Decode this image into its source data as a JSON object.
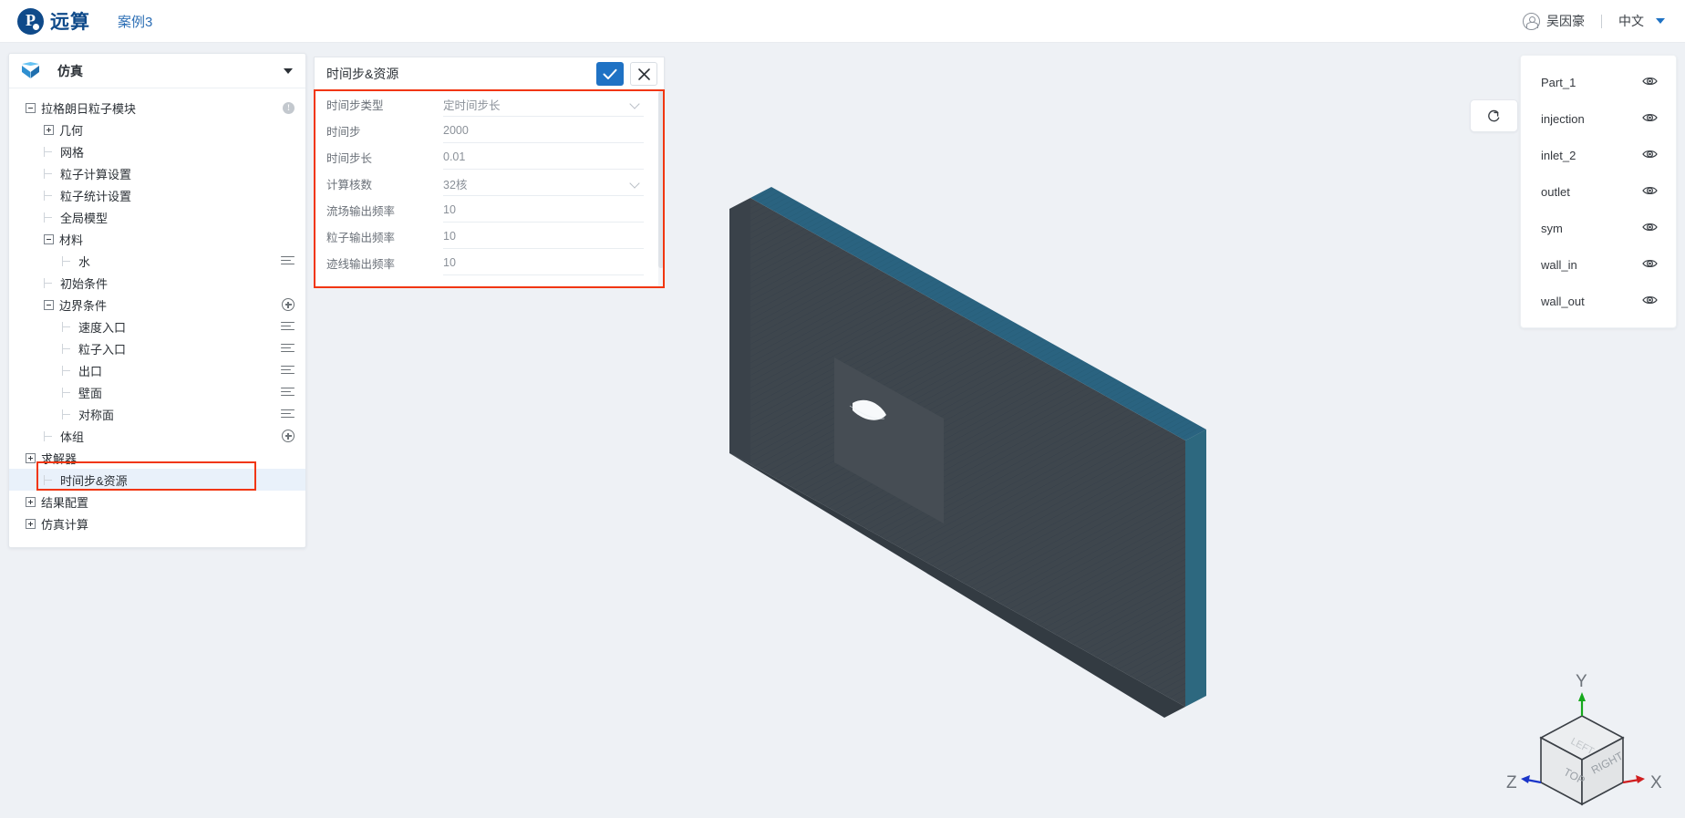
{
  "topbar": {
    "brand_name": "远算",
    "case_name": "案例3",
    "user_name": "吴因豪",
    "language": "中文"
  },
  "left_panel": {
    "header_title": "仿真",
    "tree": [
      {
        "label": "拉格朗日粒子模块",
        "toggle": "minus",
        "indent": 0,
        "tail": "info"
      },
      {
        "label": "几何",
        "toggle": "plus",
        "indent": 1,
        "tail": "none"
      },
      {
        "label": "网格",
        "toggle": "none",
        "indent": 1,
        "tail": "none"
      },
      {
        "label": "粒子计算设置",
        "toggle": "none",
        "indent": 1,
        "tail": "none"
      },
      {
        "label": "粒子统计设置",
        "toggle": "none",
        "indent": 1,
        "tail": "none"
      },
      {
        "label": "全局模型",
        "toggle": "none",
        "indent": 1,
        "tail": "none"
      },
      {
        "label": "材料",
        "toggle": "minus",
        "indent": 1,
        "tail": "none"
      },
      {
        "label": "水",
        "toggle": "none",
        "indent": 2,
        "tail": "menu"
      },
      {
        "label": "初始条件",
        "toggle": "none",
        "indent": 1,
        "tail": "none"
      },
      {
        "label": "边界条件",
        "toggle": "minus",
        "indent": 1,
        "tail": "plus"
      },
      {
        "label": "速度入口",
        "toggle": "none",
        "indent": 2,
        "tail": "menu"
      },
      {
        "label": "粒子入口",
        "toggle": "none",
        "indent": 2,
        "tail": "menu"
      },
      {
        "label": "出口",
        "toggle": "none",
        "indent": 2,
        "tail": "menu"
      },
      {
        "label": "壁面",
        "toggle": "none",
        "indent": 2,
        "tail": "menu"
      },
      {
        "label": "对称面",
        "toggle": "none",
        "indent": 2,
        "tail": "menu"
      },
      {
        "label": "体组",
        "toggle": "none",
        "indent": 1,
        "tail": "plus"
      },
      {
        "label": "求解器",
        "toggle": "plus",
        "indent": 0,
        "tail": "none"
      },
      {
        "label": "时间步&资源",
        "toggle": "none",
        "indent": 1,
        "tail": "none",
        "selected": true
      },
      {
        "label": "结果配置",
        "toggle": "plus",
        "indent": 0,
        "tail": "none"
      },
      {
        "label": "仿真计算",
        "toggle": "plus",
        "indent": 0,
        "tail": "none"
      }
    ]
  },
  "dialog": {
    "title": "时间步&资源",
    "confirm_label": "确认",
    "close_label": "关闭",
    "fields": [
      {
        "label": "时间步类型",
        "value": "定时间步长",
        "kind": "select"
      },
      {
        "label": "时间步",
        "value": "2000",
        "kind": "input"
      },
      {
        "label": "时间步长",
        "value": "0.01",
        "kind": "input"
      },
      {
        "label": "计算核数",
        "value": "32核",
        "kind": "select"
      },
      {
        "label": "流场输出频率",
        "value": "10",
        "kind": "input"
      },
      {
        "label": "粒子输出频率",
        "value": "10",
        "kind": "input"
      },
      {
        "label": "迹线输出频率",
        "value": "10",
        "kind": "input"
      }
    ]
  },
  "viewport": {
    "reset_label": "重置视角",
    "model_face_color": "#3e464d",
    "model_edge_color": "#2a6380",
    "background_color": "#eef1f5"
  },
  "right_panel": {
    "parts": [
      {
        "name": "Part_1",
        "visible": true
      },
      {
        "name": "injection",
        "visible": true
      },
      {
        "name": "inlet_2",
        "visible": true
      },
      {
        "name": "outlet",
        "visible": true
      },
      {
        "name": "sym",
        "visible": true
      },
      {
        "name": "wall_in",
        "visible": true
      },
      {
        "name": "wall_out",
        "visible": true
      }
    ]
  },
  "gizmo": {
    "axis_x": "X",
    "axis_y": "Y",
    "axis_z": "Z",
    "face_top": "TOP",
    "face_right": "RIGHT",
    "face_left": "LEFT",
    "color_x": "#d01f20",
    "color_y": "#16a81c",
    "color_z": "#1a35c9"
  },
  "highlights": {
    "accent_color": "#f1360f"
  }
}
